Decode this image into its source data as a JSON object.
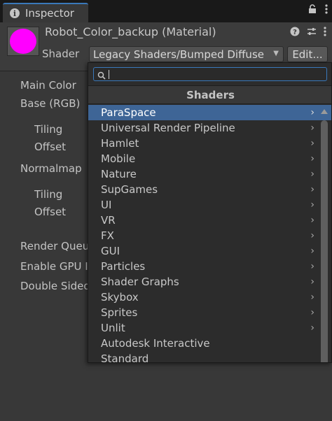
{
  "tab": {
    "label": "Inspector",
    "icon": "info-icon"
  },
  "material": {
    "title": "Robot_Color_backup (Material)",
    "swatch_color": "#ff00ff",
    "icons": [
      "help-icon",
      "preset-icon",
      "more-vertical-icon"
    ]
  },
  "shader": {
    "label": "Shader",
    "value": "Legacy Shaders/Bumped Diffuse",
    "edit_label": "Edit..."
  },
  "properties": {
    "main_color": "Main Color",
    "base": "Base (RGB)",
    "tiling_1": "Tiling",
    "offset_1": "Offset",
    "normalmap": "Normalmap",
    "tiling_2": "Tiling",
    "offset_2": "Offset",
    "render_queue": "Render Queu",
    "enable_gpu": "Enable GPU I",
    "double_sided": "Double Sided"
  },
  "popup": {
    "search_value": "",
    "header": "Shaders",
    "selected_color": "#3e6596",
    "items": [
      {
        "label": "ParaSpace",
        "submenu": true
      },
      {
        "label": "Universal Render Pipeline",
        "submenu": true
      },
      {
        "label": "Hamlet",
        "submenu": true
      },
      {
        "label": "Mobile",
        "submenu": true
      },
      {
        "label": "Nature",
        "submenu": true
      },
      {
        "label": "SupGames",
        "submenu": true
      },
      {
        "label": "UI",
        "submenu": true
      },
      {
        "label": "VR",
        "submenu": true
      },
      {
        "label": "FX",
        "submenu": true
      },
      {
        "label": "GUI",
        "submenu": true
      },
      {
        "label": "Particles",
        "submenu": true
      },
      {
        "label": "Shader Graphs",
        "submenu": true
      },
      {
        "label": "Skybox",
        "submenu": true
      },
      {
        "label": "Sprites",
        "submenu": true
      },
      {
        "label": "Unlit",
        "submenu": true
      },
      {
        "label": "Autodesk Interactive",
        "submenu": false
      },
      {
        "label": "Standard",
        "submenu": false
      }
    ]
  }
}
